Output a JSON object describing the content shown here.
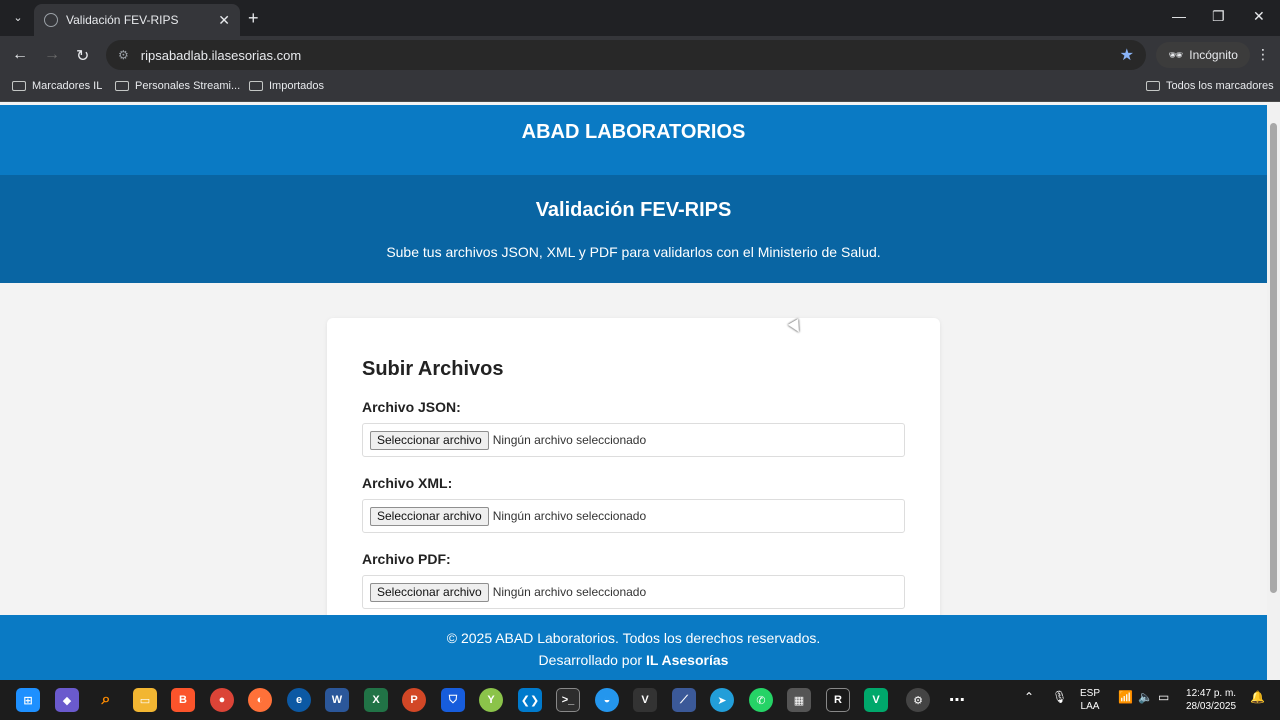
{
  "browser": {
    "tab_title": "Validación FEV-RIPS",
    "url": "ripsabadlab.ilasesorias.com",
    "incognito_label": "Incógnito",
    "bookmarks": [
      "Marcadores IL",
      "Personales Streami...",
      "Importados"
    ],
    "all_bookmarks": "Todos los marcadores"
  },
  "page": {
    "brand": "ABAD LABORATORIOS",
    "hero_title": "Validación FEV-RIPS",
    "hero_subtitle": "Sube tus archivos JSON, XML y PDF para validarlos con el Ministerio de Salud.",
    "card_title": "Subir Archivos",
    "fields": [
      {
        "label": "Archivo JSON:",
        "button": "Seleccionar archivo",
        "status": "Ningún archivo seleccionado"
      },
      {
        "label": "Archivo XML:",
        "button": "Seleccionar archivo",
        "status": "Ningún archivo seleccionado"
      },
      {
        "label": "Archivo PDF:",
        "button": "Seleccionar archivo",
        "status": "Ningún archivo seleccionado"
      }
    ],
    "footer_line1": "© 2025 ABAD Laboratorios. Todos los derechos reservados.",
    "footer_line2_prefix": "Desarrollado por",
    "footer_line2_bold": "IL Asesorías"
  },
  "taskbar": {
    "lang": "ESP",
    "lang_sub": "LAA",
    "time": "12:47 p. m.",
    "date": "28/03/2025"
  },
  "colors": {
    "brand_blue": "#0a7ac4",
    "hero_blue": "#0965a3"
  }
}
